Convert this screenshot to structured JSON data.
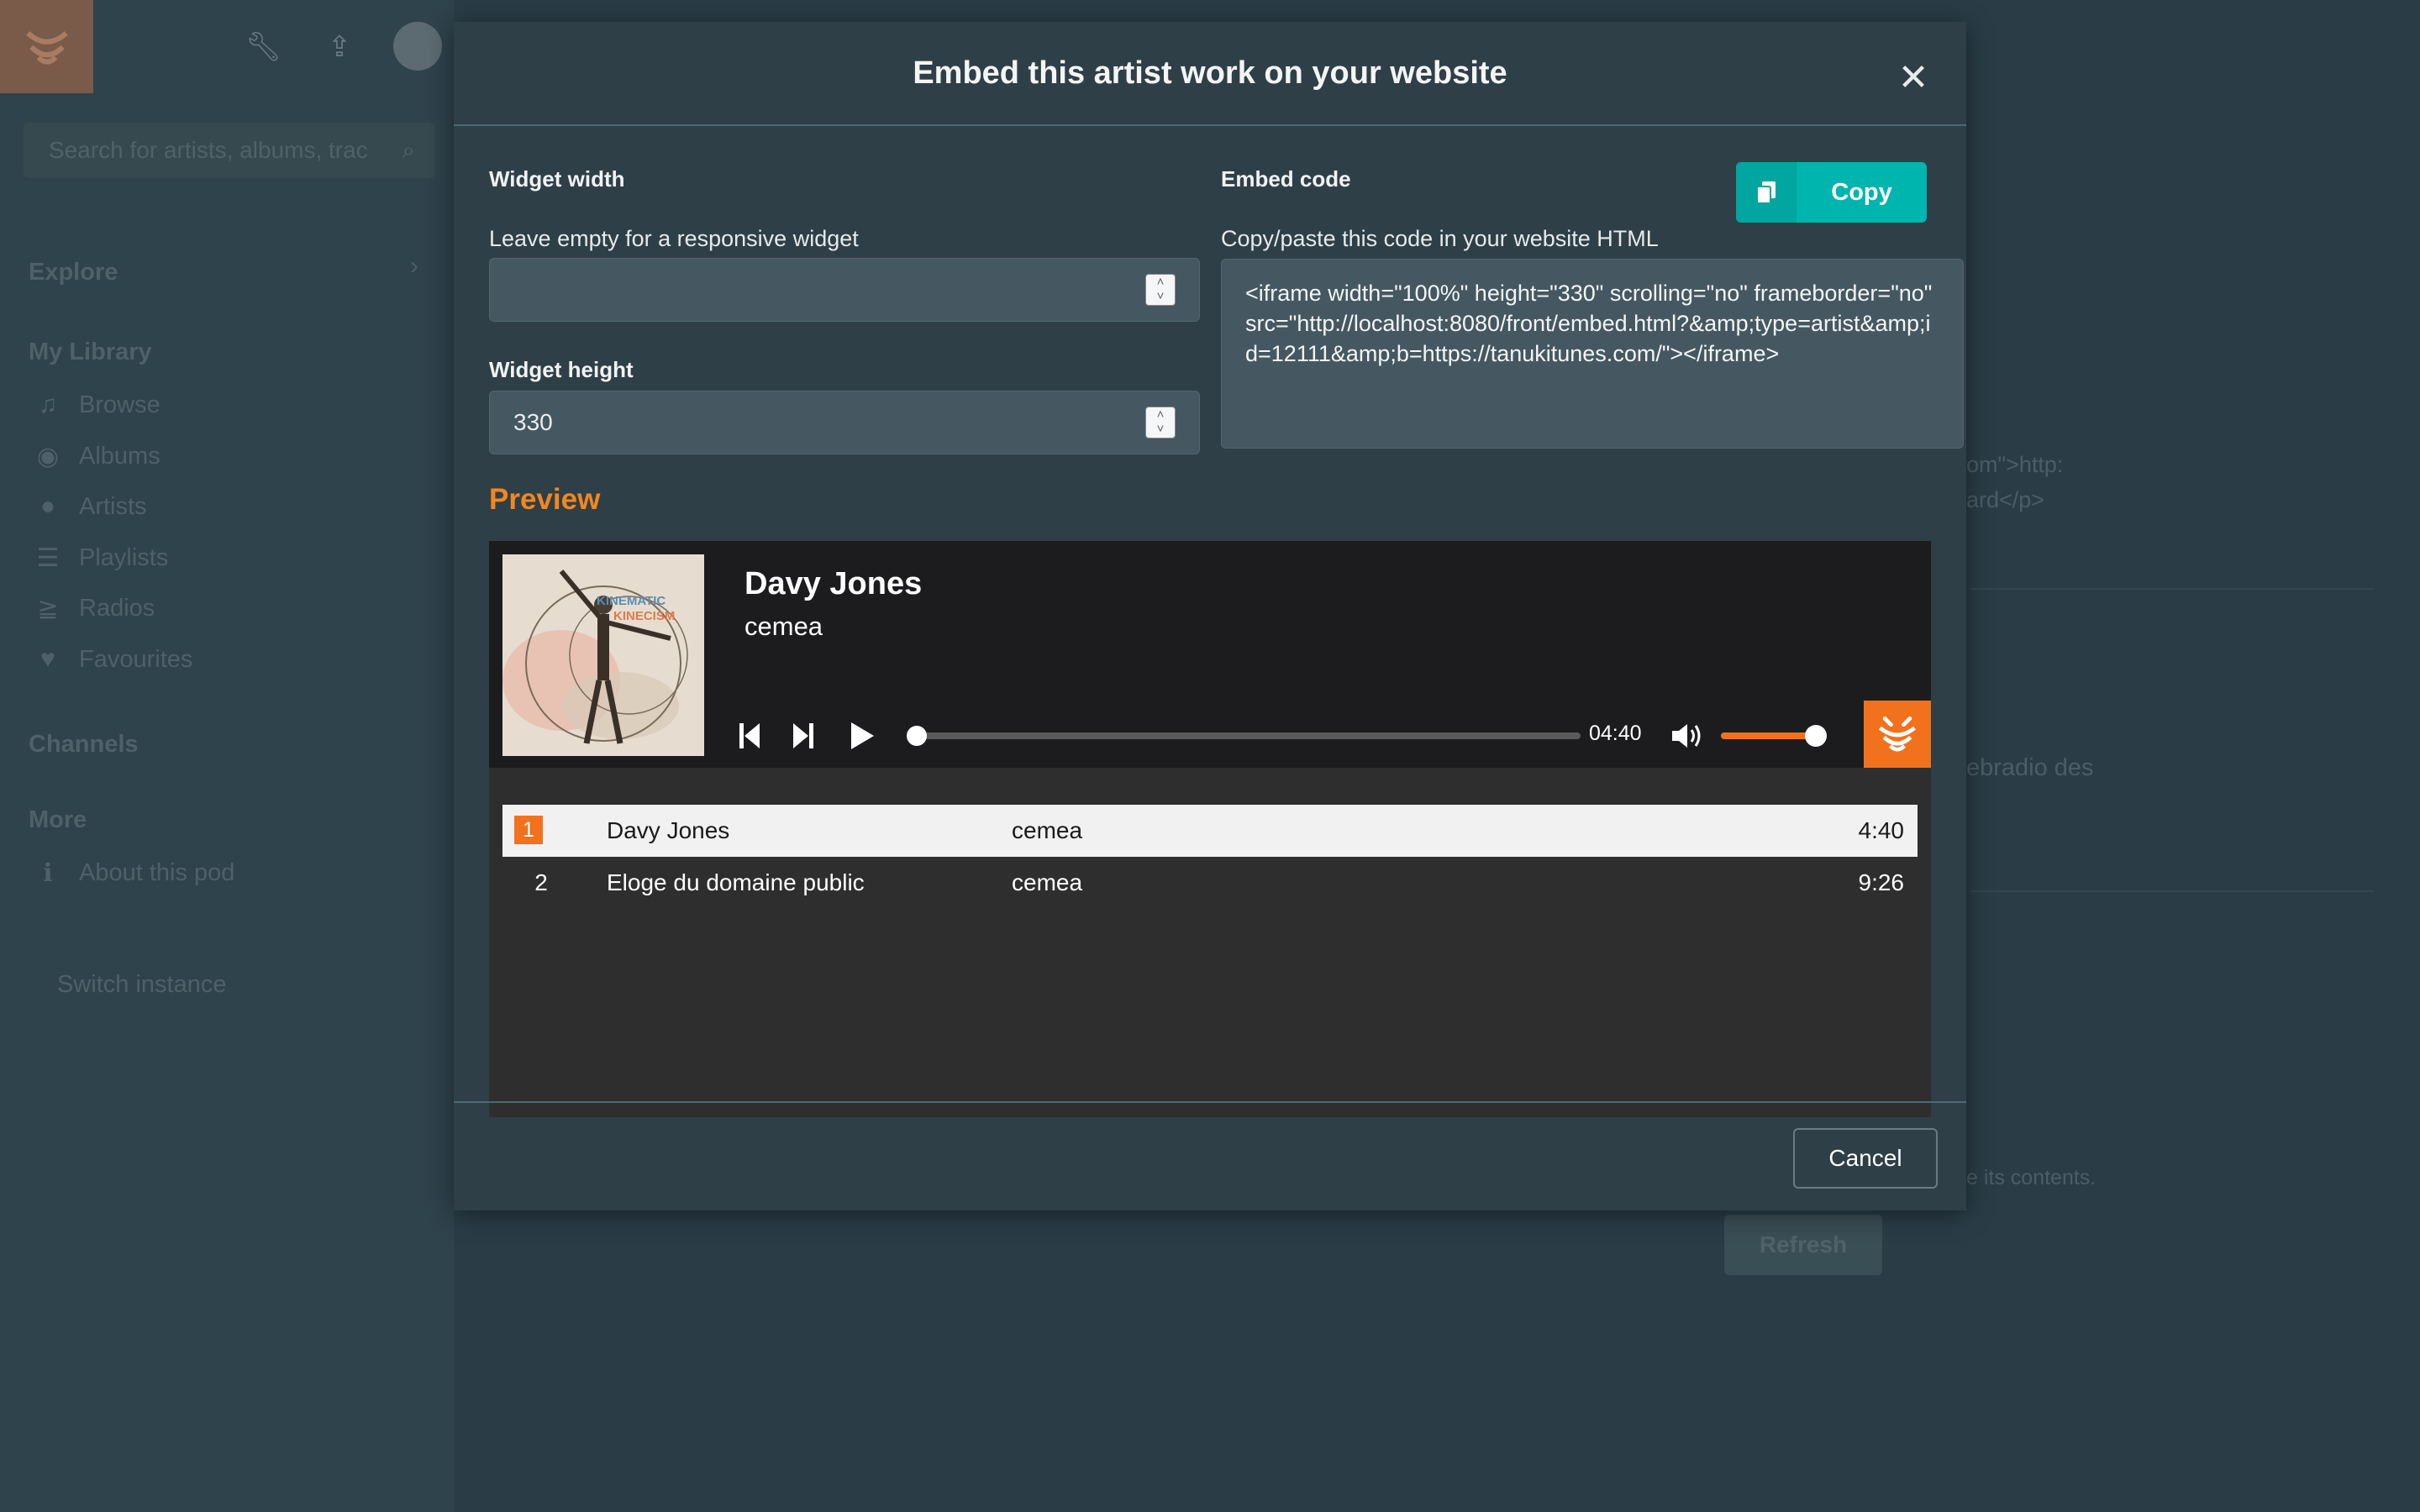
{
  "background": {
    "search_placeholder": "Search for artists, albums, trac",
    "sidebar": {
      "explore": "Explore",
      "my_library": "My Library",
      "library_items": [
        {
          "label": "Browse",
          "icon": "music-note-icon"
        },
        {
          "label": "Albums",
          "icon": "disc-icon"
        },
        {
          "label": "Artists",
          "icon": "user-icon"
        },
        {
          "label": "Playlists",
          "icon": "list-icon"
        },
        {
          "label": "Radios",
          "icon": "rss-icon"
        },
        {
          "label": "Favourites",
          "icon": "heart-icon"
        }
      ],
      "channels": "Channels",
      "more": "More",
      "about": "About this pod",
      "switch_instance": "Switch instance"
    },
    "content_fragments": {
      "code_line_1": "om\">http:",
      "code_line_2": "ard</p>",
      "text_radio": "ebradio des",
      "text_contents": "e its contents.",
      "refresh": "Refresh"
    }
  },
  "modal": {
    "title": "Embed this artist work on your website",
    "width_label": "Widget width",
    "width_help": "Leave empty for a responsive widget",
    "width_value": "",
    "height_label": "Widget height",
    "height_value": "330",
    "embed_label": "Embed code",
    "embed_help": "Copy/paste this code in your website HTML",
    "copy_label": "Copy",
    "embed_code": "<iframe width=\"100%\" height=\"330\" scrolling=\"no\" frameborder=\"no\" src=\"http://localhost:8080/front/embed.html?&amp;type=artist&amp;id=12111&amp;b=https://tanukitunes.com/\"></iframe>",
    "preview_title": "Preview",
    "cancel_label": "Cancel"
  },
  "player": {
    "current_title": "Davy Jones",
    "current_artist": "cemea",
    "cover_text_1": "KINEMATIC",
    "cover_text_2": "KINECISM",
    "time": "04:40",
    "progress": 0.0,
    "volume": 0.9,
    "tracks": [
      {
        "num": "1",
        "title": "Davy Jones",
        "artist": "cemea",
        "duration": "4:40"
      },
      {
        "num": "2",
        "title": "Eloge du domaine public",
        "artist": "cemea",
        "duration": "9:26"
      }
    ]
  },
  "colors": {
    "accent_orange": "#f2711c",
    "preview_orange": "#f2871f",
    "copy_teal": "#00b5ad"
  }
}
